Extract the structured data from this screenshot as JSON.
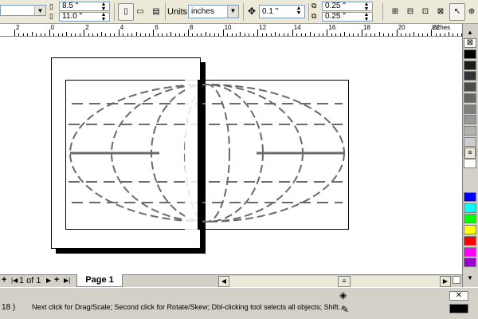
{
  "property_bar": {
    "page_width": "8.5 \"",
    "page_height": "11.0 \"",
    "units_label": "Units:",
    "units_value": "inches",
    "nudge_value": "0.1 \"",
    "duplicate_x": "0.25 \"",
    "duplicate_y": "0.25 \""
  },
  "ruler": {
    "unit_label": "inches",
    "labels": [
      "2",
      "0",
      "2",
      "4",
      "6",
      "8",
      "10",
      "12",
      "14",
      "16",
      "18",
      "20",
      "22"
    ]
  },
  "palette": {
    "colors": [
      "#000000",
      "#1c1c1c",
      "#333333",
      "#4d4d4d",
      "#666666",
      "#808080",
      "#999999",
      "#b3b3b3",
      "#cccccc",
      "#e6e6e6",
      "#ffffff",
      "#0000ff",
      "#00ffff",
      "#00ff00",
      "#ffff00",
      "#ff0000",
      "#ff00ff",
      "#9900cc"
    ]
  },
  "tabs": {
    "page_counter": "1 of 1",
    "page_tab": "Page 1"
  },
  "status": {
    "left_text": "18 )",
    "hint": "Next click for Drag/Scale; Second click for Rotate/Skew; Dbl-clicking tool selects all objects; Shift..."
  }
}
